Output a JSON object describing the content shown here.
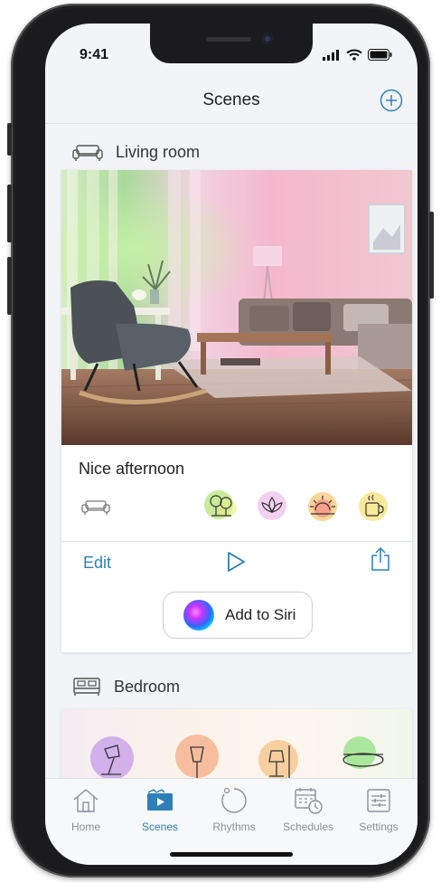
{
  "status": {
    "time": "9:41"
  },
  "header": {
    "title": "Scenes"
  },
  "rooms": [
    {
      "name": "Living room",
      "scene": {
        "name": "Nice afternoon",
        "moods": [
          "trees-icon",
          "lotus-icon",
          "sunset-icon",
          "coffee-icon"
        ]
      }
    },
    {
      "name": "Bedroom"
    }
  ],
  "actions": {
    "edit": "Edit",
    "siri": "Add to Siri"
  },
  "tabs": [
    {
      "label": "Home",
      "icon": "home-icon"
    },
    {
      "label": "Scenes",
      "icon": "scenes-icon"
    },
    {
      "label": "Rhythms",
      "icon": "rhythms-icon"
    },
    {
      "label": "Schedules",
      "icon": "schedules-icon"
    },
    {
      "label": "Settings",
      "icon": "settings-icon"
    }
  ],
  "colors": {
    "accent": "#2f7fb8",
    "background": "#f2f4f7"
  }
}
